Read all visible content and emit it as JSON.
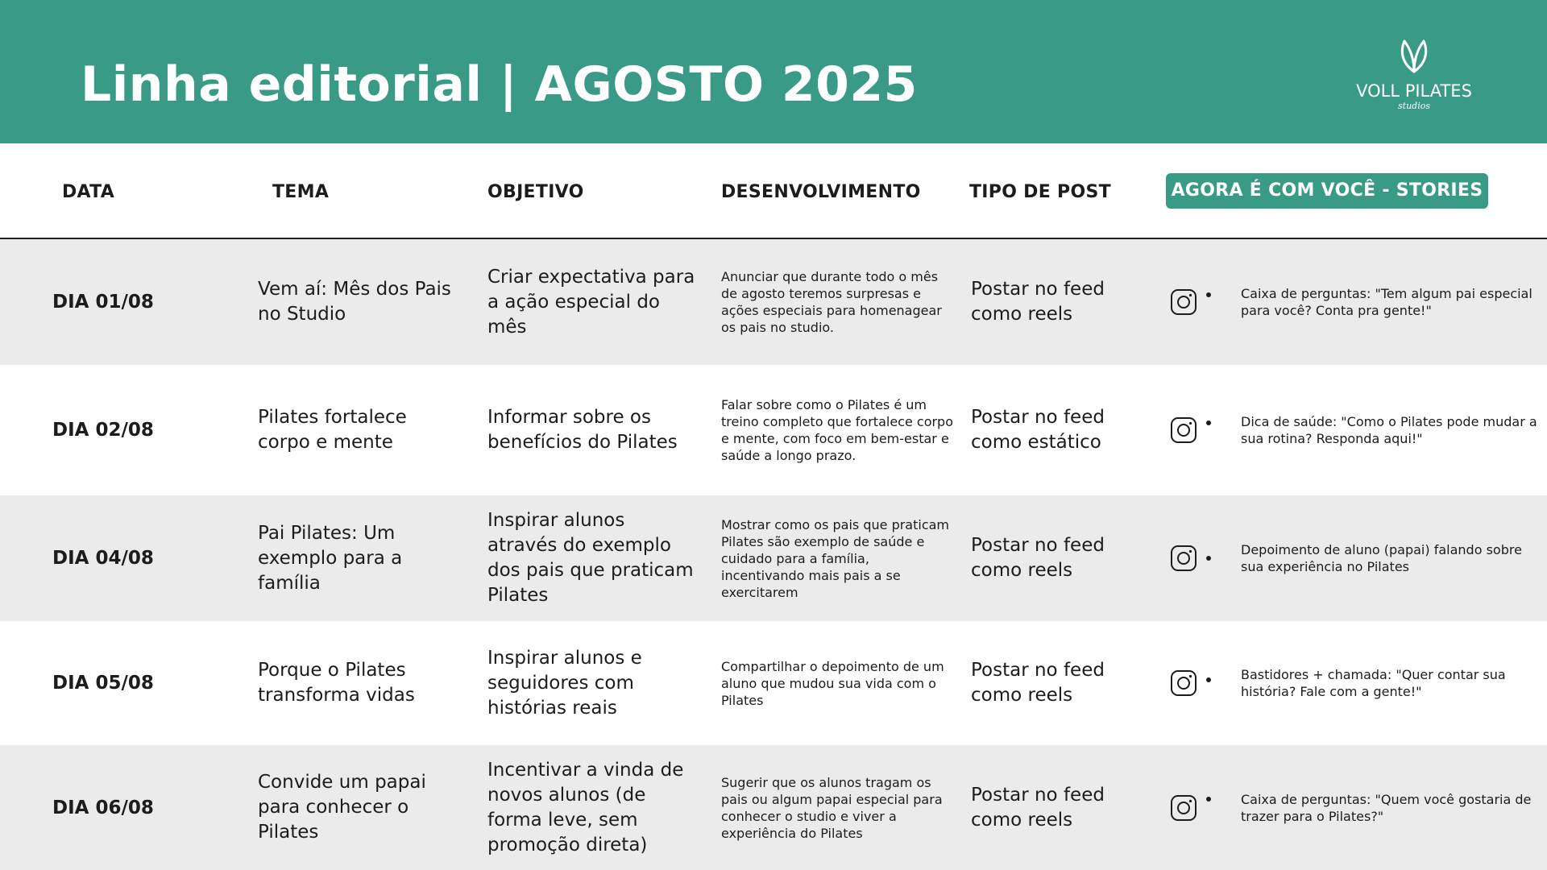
{
  "header": {
    "title": "Linha editorial | AGOSTO 2025",
    "logo_text": "VOLL PILATES",
    "logo_sub": "studios",
    "bg_color": "#399a86"
  },
  "columns": {
    "data": "DATA",
    "tema": "TEMA",
    "objetivo": "OBJETIVO",
    "desenvolvimento": "DESENVOLVIMENTO",
    "tipo": "TIPO DE POST",
    "stories": "AGORA É COM VOCÊ - STORIES"
  },
  "rows": [
    {
      "date": "DIA 01/08",
      "tema": "Vem aí: Mês dos Pais no Studio",
      "objetivo": "Criar expectativa para a ação especial do mês",
      "desenvolvimento": "Anunciar que durante todo o mês de agosto teremos surpresas e ações especiais para homenagear os pais no studio.",
      "tipo": "Postar no feed como reels",
      "icon": "instagram-icon",
      "stories": "Caixa de perguntas: \"Tem algum pai especial para você? Conta pra gente!\""
    },
    {
      "date": "DIA 02/08",
      "tema": "Pilates fortalece corpo e mente",
      "objetivo": "Informar sobre os benefícios do Pilates",
      "desenvolvimento": "Falar sobre como o Pilates é um treino completo que fortalece corpo e mente, com foco em bem-estar e saúde a longo prazo.",
      "tipo": "Postar no feed como estático",
      "icon": "instagram-icon",
      "stories": "Dica de saúde: \"Como o Pilates pode mudar a sua rotina? Responda aqui!\""
    },
    {
      "date": "DIA 04/08",
      "tema": "Pai Pilates: Um exemplo para a família",
      "objetivo": "Inspirar alunos através do exemplo dos pais que praticam Pilates",
      "desenvolvimento": "Mostrar como os pais que praticam Pilates são exemplo de saúde e cuidado para a família, incentivando mais pais a se exercitarem",
      "tipo": "Postar no feed como reels",
      "icon": "instagram-icon",
      "stories": "Depoimento de aluno (papai) falando sobre sua experiência no Pilates"
    },
    {
      "date": "DIA 05/08",
      "tema": "Porque o Pilates transforma vidas",
      "objetivo": "Inspirar alunos e seguidores com histórias reais",
      "desenvolvimento": "Compartilhar o depoimento de um aluno que mudou sua vida com o Pilates",
      "tipo": "Postar no feed como reels",
      "icon": "instagram-icon",
      "stories": "Bastidores + chamada: \"Quer contar sua história? Fale com a gente!\""
    },
    {
      "date": "DIA 06/08",
      "tema": "Convide um papai para conhecer o Pilates",
      "objetivo": "Incentivar a vinda de novos alunos (de forma leve, sem promoção direta)",
      "desenvolvimento": "Sugerir que os alunos tragam os pais ou algum papai especial para conhecer o studio e viver a experiência do Pilates",
      "tipo": "Postar no feed como reels",
      "icon": "instagram-icon",
      "stories": "Caixa de perguntas: \"Quem você gostaria de trazer para o Pilates?\""
    }
  ]
}
